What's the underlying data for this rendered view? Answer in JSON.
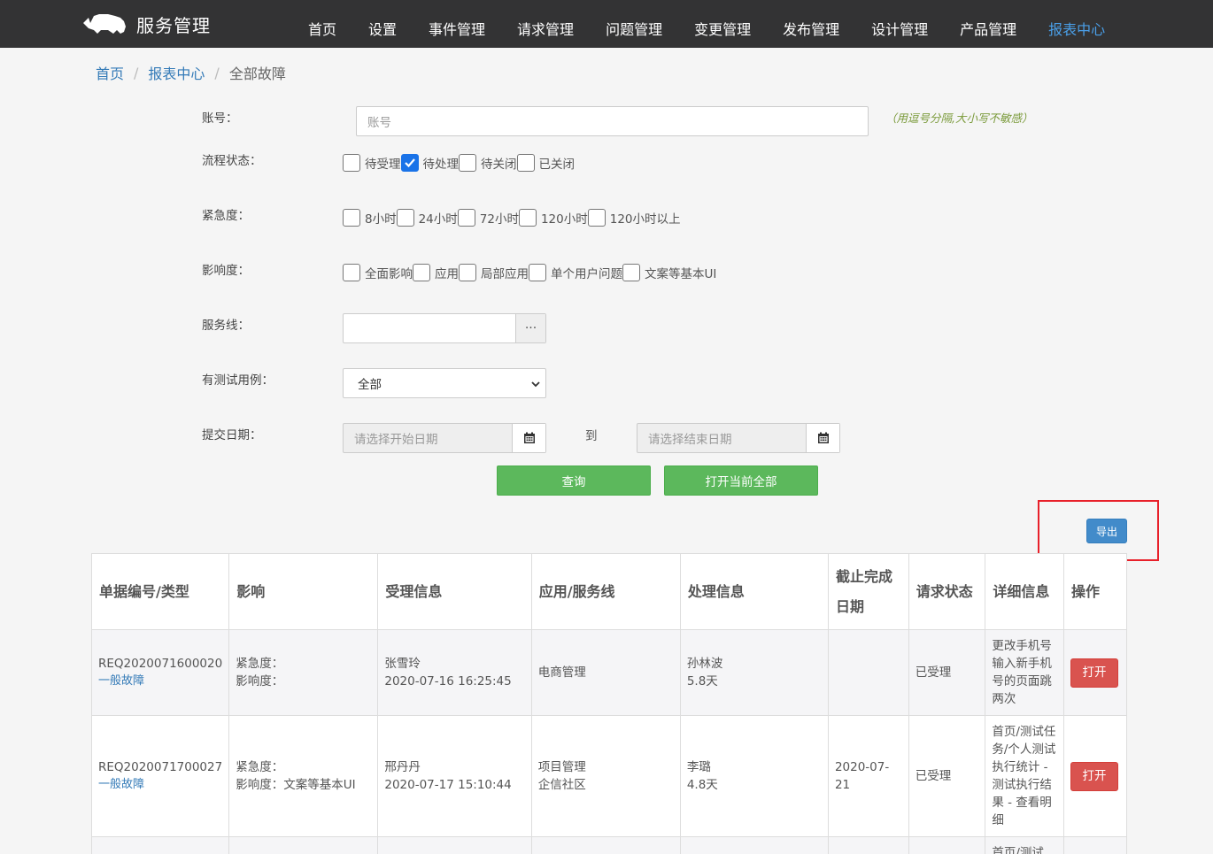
{
  "app": {
    "brand": "服务管理"
  },
  "nav": [
    "首页",
    "设置",
    "事件管理",
    "请求管理",
    "问题管理",
    "变更管理",
    "发布管理",
    "设计管理",
    "产品管理",
    "报表中心"
  ],
  "nav_active_index": 9,
  "breadcrumb": {
    "home": "首页",
    "section": "报表中心",
    "current": "全部故障"
  },
  "form": {
    "account": {
      "label": "账号：",
      "placeholder": "账号",
      "hint": "（用逗号分隔,大小写不敏感）"
    },
    "status": {
      "label": "流程状态：",
      "options": [
        {
          "text": "待受理",
          "checked": false
        },
        {
          "text": "待处理",
          "checked": true
        },
        {
          "text": "待关闭",
          "checked": false
        },
        {
          "text": "已关闭",
          "checked": false
        }
      ]
    },
    "urgency": {
      "label": "紧急度：",
      "options": [
        {
          "text": "8小时",
          "checked": false
        },
        {
          "text": "24小时",
          "checked": false
        },
        {
          "text": "72小时",
          "checked": false
        },
        {
          "text": "120小时",
          "checked": false
        },
        {
          "text": "120小时以上",
          "checked": false
        }
      ]
    },
    "impact": {
      "label": "影响度：",
      "options": [
        {
          "text": "全面影响",
          "checked": false
        },
        {
          "text": "应用",
          "checked": false
        },
        {
          "text": "局部应用",
          "checked": false
        },
        {
          "text": "单个用户问题",
          "checked": false
        },
        {
          "text": "文案等基本UI",
          "checked": false
        }
      ]
    },
    "service_line": {
      "label": "服务线：",
      "value": "",
      "button": "···"
    },
    "test_case": {
      "label": "有测试用例：",
      "selected": "全部"
    },
    "date": {
      "label": "提交日期：",
      "start_placeholder": "请选择开始日期",
      "to": "到",
      "end_placeholder": "请选择结束日期"
    },
    "query_button": "查询",
    "open_all_button": "打开当前全部",
    "export_button": "导出"
  },
  "table": {
    "headers": [
      "单据编号/类型",
      "影响",
      "受理信息",
      "应用/服务线",
      "处理信息",
      "截止完成日期",
      "请求状态",
      "详细信息",
      "操作"
    ],
    "rows": [
      {
        "id": "REQ2020071600020",
        "type": "一般故障",
        "urgency": "紧急度：",
        "impact": "影响度：",
        "handler": "张雪玲",
        "accept_time": "2020-07-16 16:25:45",
        "app": "电商管理",
        "service_line": "",
        "processor": "孙林波",
        "duration": "5.8天",
        "deadline": "",
        "status": "已受理",
        "detail": "更改手机号输入新手机号的页面跳两次",
        "action": "打开"
      },
      {
        "id": "REQ2020071700027",
        "type": "一般故障",
        "urgency": "紧急度：",
        "impact": "影响度：文案等基本UI",
        "handler": "邢丹丹",
        "accept_time": "2020-07-17 15:10:44",
        "app": "项目管理",
        "service_line": "企信社区",
        "processor": "李璐",
        "duration": "4.8天",
        "deadline": "2020-07-21",
        "status": "已受理",
        "detail": "首页/测试任务/个人测试执行统计 - 测试执行结果 - 查看明细",
        "action": "打开"
      }
    ],
    "partial_row_detail": "首页/测试"
  },
  "colors": {
    "topbar": "#333334",
    "nav_active": "#4a9fe8",
    "green": "#5cb85c",
    "blue": "#428bca",
    "red": "#d9534f",
    "highlight": "#e8202a"
  }
}
